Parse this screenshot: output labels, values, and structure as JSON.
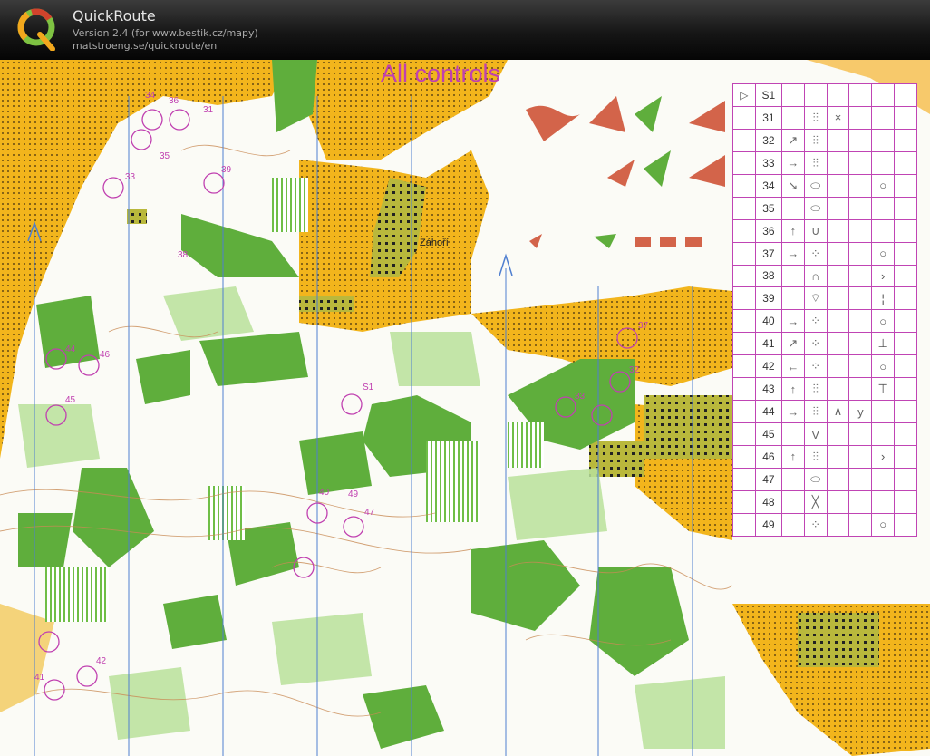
{
  "app": {
    "title": "QuickRoute",
    "version": "Version 2.4  (for www.bestik.cz/mapy)",
    "url": "matstroeng.se/quickroute/en",
    "logo_letter": "Q",
    "logo_icon": "quickroute-logo-icon"
  },
  "map": {
    "title": "All controls",
    "place_name": "Záhoří",
    "start_label": "S1",
    "control_labels": [
      "34",
      "31",
      "36",
      "35",
      "33",
      "39",
      "38",
      "44",
      "46",
      "45",
      "37",
      "32",
      "33",
      "40",
      "49",
      "47",
      "42",
      "41"
    ],
    "north_arrow_icon": "north-arrow-icon"
  },
  "description_sheet": {
    "start": {
      "code": "S1",
      "symbol": "start-triangle-icon"
    },
    "rows": [
      {
        "code": "31",
        "direction": "",
        "feature": "crosshatch",
        "extra": "×",
        "extra2": "",
        "detail": ""
      },
      {
        "code": "32",
        "direction": "↗",
        "feature": "crosshatch",
        "extra": "",
        "extra2": "",
        "detail": ""
      },
      {
        "code": "33",
        "direction": "→",
        "feature": "crosshatch",
        "extra": "",
        "extra2": "",
        "detail": ""
      },
      {
        "code": "34",
        "direction": "↘",
        "feature": "oval",
        "extra": "",
        "extra2": "",
        "detail": "○"
      },
      {
        "code": "35",
        "direction": "",
        "feature": "oval",
        "extra": "",
        "extra2": "",
        "detail": ""
      },
      {
        "code": "36",
        "direction": "↑",
        "feature": "∪",
        "extra": "",
        "extra2": "",
        "detail": ""
      },
      {
        "code": "37",
        "direction": "→",
        "feature": "dotted-circle",
        "extra": "",
        "extra2": "",
        "detail": "○"
      },
      {
        "code": "38",
        "direction": "",
        "feature": "∩",
        "extra": "",
        "extra2": "",
        "detail": "›"
      },
      {
        "code": "39",
        "direction": "",
        "feature": "fringe",
        "extra": "",
        "extra2": "",
        "detail": "¦"
      },
      {
        "code": "40",
        "direction": "→",
        "feature": "dotted-circle",
        "extra": "",
        "extra2": "",
        "detail": "○"
      },
      {
        "code": "41",
        "direction": "↗",
        "feature": "dotted-circle",
        "extra": "",
        "extra2": "",
        "detail": "⊥"
      },
      {
        "code": "42",
        "direction": "←",
        "feature": "dotted-circle",
        "extra": "",
        "extra2": "",
        "detail": "○"
      },
      {
        "code": "43",
        "direction": "↑",
        "feature": "crosshatch",
        "extra": "",
        "extra2": "",
        "detail": "⊤"
      },
      {
        "code": "44",
        "direction": "→",
        "feature": "crosshatch",
        "extra": "∧",
        "extra2": "y",
        "detail": ""
      },
      {
        "code": "45",
        "direction": "",
        "feature": "V",
        "extra": "",
        "extra2": "",
        "detail": ""
      },
      {
        "code": "46",
        "direction": "↑",
        "feature": "crosshatch",
        "extra": "",
        "extra2": "",
        "detail": "›"
      },
      {
        "code": "47",
        "direction": "",
        "feature": "oval",
        "extra": "",
        "extra2": "",
        "detail": ""
      },
      {
        "code": "48",
        "direction": "",
        "feature": "╳",
        "extra": "",
        "extra2": "",
        "detail": ""
      },
      {
        "code": "49",
        "direction": "",
        "feature": "dotted-circle",
        "extra": "",
        "extra2": "",
        "detail": "○"
      }
    ]
  },
  "colors": {
    "open_land": "#f2b51c",
    "forest_green": "#5fae3c",
    "light_green": "#b9e09a",
    "control_magenta": "#c040b0",
    "water_blue": "#4f7fd0",
    "contour_brown": "#c98b55",
    "cultivated": "#b7b43a"
  }
}
